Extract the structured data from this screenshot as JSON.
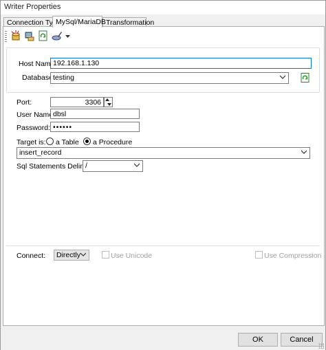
{
  "window": {
    "title": "Writer Properties"
  },
  "tabs": [
    {
      "label": "Connection Type"
    },
    {
      "label": "MySql/MariaDB"
    },
    {
      "label": "Transformation"
    }
  ],
  "toolbar": {
    "buttons": [
      "database-wizard-icon",
      "server-icon",
      "refresh-icon",
      "edit-icon"
    ]
  },
  "connection": {
    "host_label": "Host Name:",
    "host_value": "192.168.1.130",
    "database_label": "Database:",
    "database_value": "testing",
    "port_label": "Port:",
    "port_value": "3306",
    "user_label": "User Name:",
    "user_value": "dbsl",
    "password_label": "Password:",
    "password_value": "••••••"
  },
  "target": {
    "label": "Target is:",
    "option_table": "a Table",
    "option_procedure": "a Procedure",
    "selected": "a Procedure",
    "value": "insert_record",
    "delimiter_label": "Sql Statements Delimiter:",
    "delimiter_value": "/"
  },
  "connect": {
    "label": "Connect:",
    "mode_value": "Directly",
    "unicode_label": "Use Unicode",
    "compression_label": "Use Compression"
  },
  "buttons": {
    "ok": "OK",
    "cancel": "Cancel"
  },
  "colors": {
    "focus": "#0078d7",
    "border": "#7a7a7a",
    "group_border": "#d5dfe5"
  }
}
